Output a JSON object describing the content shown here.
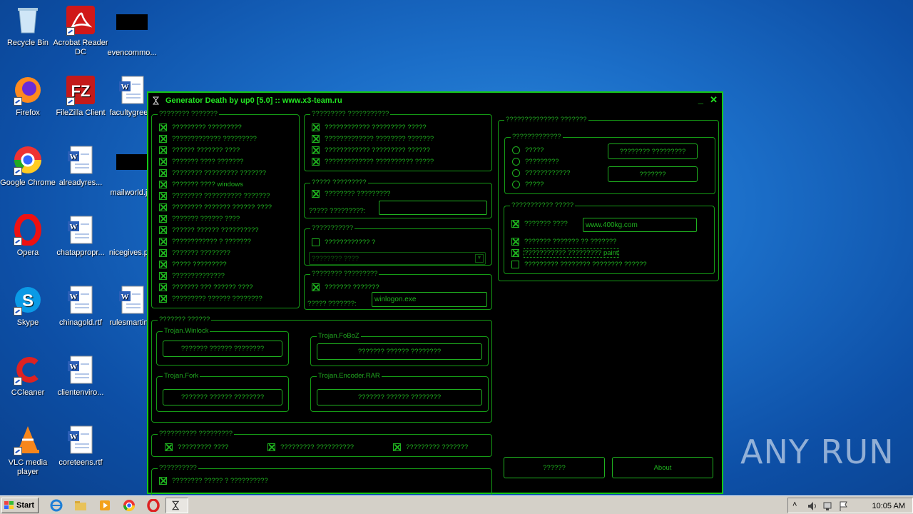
{
  "desktop": {
    "icons": [
      {
        "label": "Recycle Bin",
        "icon": "recycle-bin-icon"
      },
      {
        "label": "Acrobat Reader DC",
        "icon": "acrobat-icon"
      },
      {
        "label": "evencommo...",
        "icon": "redacted-icon"
      },
      {
        "label": "Firefox",
        "icon": "firefox-icon"
      },
      {
        "label": "FileZilla Client",
        "icon": "filezilla-icon"
      },
      {
        "label": "facultygree...",
        "icon": "word-doc-icon"
      },
      {
        "label": "Google Chrome",
        "icon": "chrome-icon"
      },
      {
        "label": "alreadyres...",
        "icon": "word-doc-icon"
      },
      {
        "label": "mailworld.j...",
        "icon": "redacted-icon"
      },
      {
        "label": "Opera",
        "icon": "opera-icon"
      },
      {
        "label": "chatappropr...",
        "icon": "word-doc-icon"
      },
      {
        "label": "nicegives.p...",
        "icon": "blank-icon"
      },
      {
        "label": "Skype",
        "icon": "skype-icon"
      },
      {
        "label": "chinagold.rtf",
        "icon": "word-doc-icon"
      },
      {
        "label": "rulesmartin...",
        "icon": "word-doc-icon"
      },
      {
        "label": "CCleaner",
        "icon": "ccleaner-icon"
      },
      {
        "label": "clientenviro...",
        "icon": "word-doc-icon"
      },
      {
        "label": "VLC media player",
        "icon": "vlc-icon"
      },
      {
        "label": "coreteens.rtf",
        "icon": "word-doc-icon"
      }
    ]
  },
  "window": {
    "title": "Generator Death by up0 [5.0] :: www.x3-team.ru",
    "minimize": "_",
    "close": "✕",
    "group1": {
      "title": "???????? ???????",
      "items": [
        "????????? ?????????",
        "????????????? ?????????",
        "?????? ??????? ????",
        "??????? ???? ???????",
        "???????? ????????? ???????",
        "??????? ???? windows",
        "???????? ?????????? ???????",
        "???????? ??????? ?????? ????",
        "??????? ?????? ????",
        "?????? ?????? ??????????",
        "???????????? ? ???????",
        "??????? ????????",
        "????? ?????????",
        "??????????????",
        "??????? ??? ?????? ????",
        "????????? ?????? ????????"
      ]
    },
    "group2": {
      "title": "????????? ???????????",
      "items": [
        "???????????? ????????? ?????",
        "????????????? ???????? ???????",
        "???????????? ????????? ??????",
        "????????????? ?????????? ?????"
      ]
    },
    "group3": {
      "title": "????? ?????????",
      "checkbox": "???????? ?????????",
      "label": "????? ?????????:",
      "value": ""
    },
    "group4": {
      "title": "???????????",
      "checkbox": "???????????? ?",
      "select": "???????? ????"
    },
    "group5": {
      "title": "???????? ?????????",
      "checkbox": "??????? ???????",
      "label": "????? ???????:",
      "value": "winlogon.exe"
    },
    "group6": {
      "title": "??????? ??????",
      "subgroups": [
        {
          "title": "Trojan.Winlock",
          "button": "??????? ?????? ????????"
        },
        {
          "title": "Trojan.FoBoZ",
          "button": "??????? ?????? ????????"
        },
        {
          "title": "Trojan.Fork",
          "button": "??????? ?????? ????????"
        },
        {
          "title": "Trojan.Encoder.RAR",
          "button": "??????? ?????? ????????"
        }
      ]
    },
    "group7": {
      "title": "?????????? ?????????",
      "items": [
        "????????? ????",
        "????????? ??????????",
        "????????? ???????"
      ]
    },
    "group8": {
      "title": "??????????",
      "checkbox": "???????? ????? ? ??????????"
    },
    "group9": {
      "title": "?????????????? ???????",
      "radio_title": "?????????????",
      "radios": [
        "?????",
        "?????????",
        "????????????",
        "?????"
      ],
      "button1": "???????? ?????????",
      "button2": "???????"
    },
    "group10": {
      "title": "??????????? ?????",
      "items": [
        {
          "label": "??????? ????",
          "checked": true,
          "value": "www.400kg.com"
        },
        {
          "label": "??????? ??????? ?? ???????",
          "checked": true
        },
        {
          "label": "??????????? ????????? paint",
          "checked": true
        },
        {
          "label": "????????? ???????? ???????? ??????",
          "checked": false
        }
      ]
    },
    "bottom_button": "??????",
    "about_button": "About"
  },
  "taskbar": {
    "start": "Start",
    "clock": "10:05 AM"
  },
  "watermark": "ANY RUN"
}
